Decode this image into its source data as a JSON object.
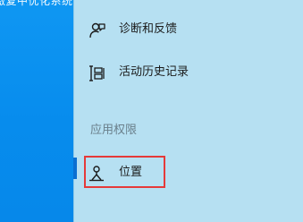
{
  "desktop": {
    "icon_label_fragment": "激复中优化系统"
  },
  "settings_panel": {
    "items": [
      {
        "label": "诊断和反馈",
        "icon": "feedback-person-icon"
      },
      {
        "label": "活动历史记录",
        "icon": "timeline-history-icon"
      }
    ],
    "section_header": "应用权限",
    "app_permissions": [
      {
        "label": "位置",
        "icon": "location-person-icon",
        "selected": true
      }
    ]
  },
  "colors": {
    "desktop_blue": "#0a8ef0",
    "panel_background": "#b6e0f2",
    "selection_bar": "#0a6fd1",
    "annotation_box": "#e53a3a"
  }
}
